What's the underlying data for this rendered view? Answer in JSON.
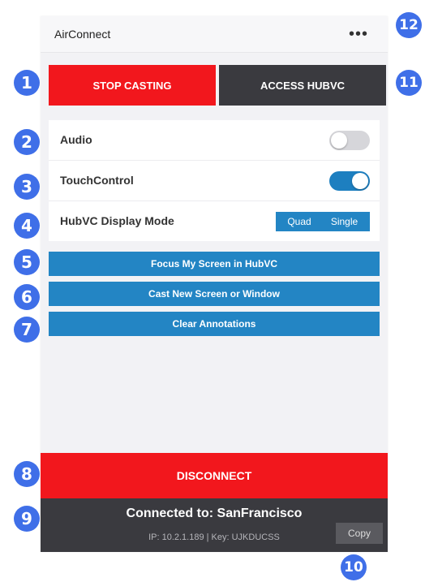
{
  "app": {
    "title": "AirConnect",
    "more_icon": "more-dots-icon",
    "more_label": "•••"
  },
  "top_buttons": {
    "stop_casting": "STOP CASTING",
    "access_hubvc": "ACCESS HUBVC"
  },
  "settings": {
    "audio": {
      "label": "Audio",
      "enabled": false
    },
    "touch_control": {
      "label": "TouchControl",
      "enabled": true
    },
    "display_mode": {
      "label": "HubVC Display Mode",
      "options": [
        "Quad",
        "Single"
      ]
    }
  },
  "actions": {
    "focus": "Focus My Screen in HubVC",
    "cast": "Cast New Screen or Window",
    "clear": "Clear Annotations"
  },
  "footer": {
    "disconnect": "DISCONNECT",
    "connected": "Connected to: SanFrancisco",
    "ip_key": "IP: 10.2.1.189 | Key: UJKDUCSS",
    "copy": "Copy"
  },
  "callouts": [
    "1",
    "2",
    "3",
    "4",
    "5",
    "6",
    "7",
    "8",
    "9",
    "10",
    "11",
    "12"
  ],
  "colors": {
    "red": "#f2171d",
    "dark": "#3a3a3f",
    "blue": "#2385c4",
    "toggle_on": "#1d7fc0",
    "badge": "#3f6fe8"
  }
}
